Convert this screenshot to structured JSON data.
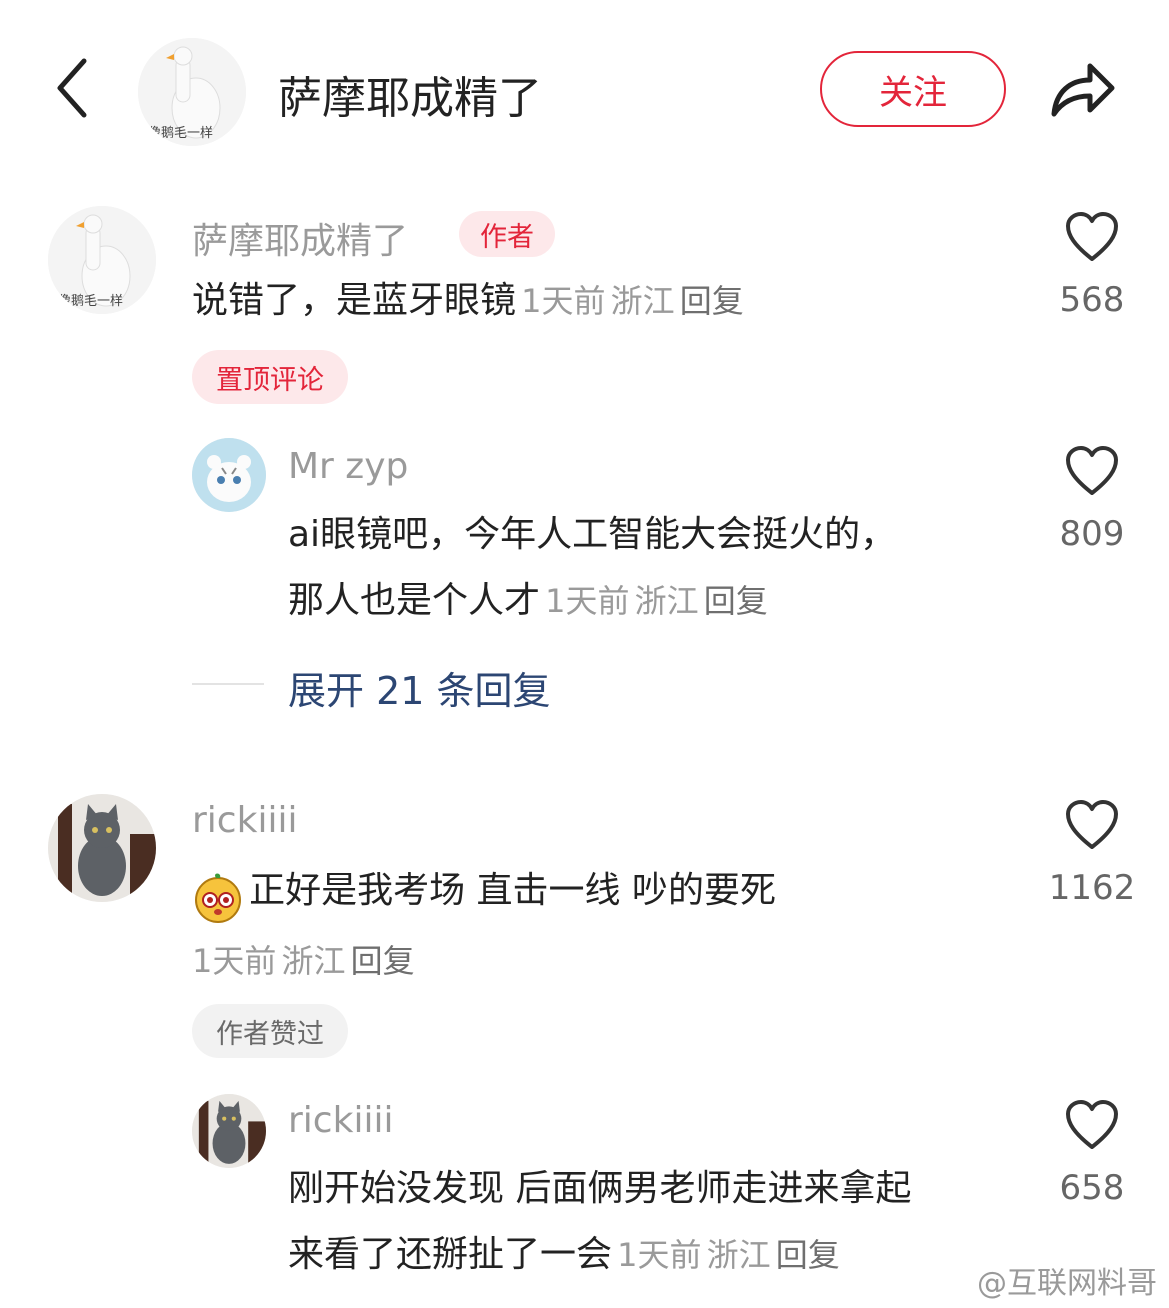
{
  "header": {
    "title": "萨摩耶成精了",
    "follow_label": "关注"
  },
  "comments": [
    {
      "username": "萨摩耶成精了",
      "badge": "作者",
      "text": "说错了，是蓝牙眼镜",
      "time": "1天前",
      "location": "浙江",
      "reply_label": "回复",
      "likes": "568",
      "tag": "置顶评论"
    },
    {
      "username": "Mr  zyp",
      "text_line1": "ai眼镜吧，今年人工智能大会挺火的，",
      "text_line2": "那人也是个人才",
      "time": "1天前",
      "location": "浙江",
      "reply_label": "回复",
      "likes": "809",
      "expand_label": "展开 21 条回复"
    },
    {
      "username": "rickiiii",
      "text": "正好是我考场 直击一线 吵的要死",
      "time": "1天前",
      "location": "浙江",
      "reply_label": "回复",
      "likes": "1162",
      "tag": "作者赞过"
    },
    {
      "username": "rickiiii",
      "text_line1": "刚开始没发现 后面俩男老师走进来拿起",
      "text_line2": "来看了还掰扯了一会",
      "time": "1天前",
      "location": "浙江",
      "reply_label": "回复",
      "likes": "658"
    }
  ],
  "avatar_caption": "像鹅毛一样",
  "watermark": "@互联网料哥",
  "colors": {
    "accent": "#e3253a",
    "link": "#2c4673",
    "muted": "#9a9a9a"
  }
}
